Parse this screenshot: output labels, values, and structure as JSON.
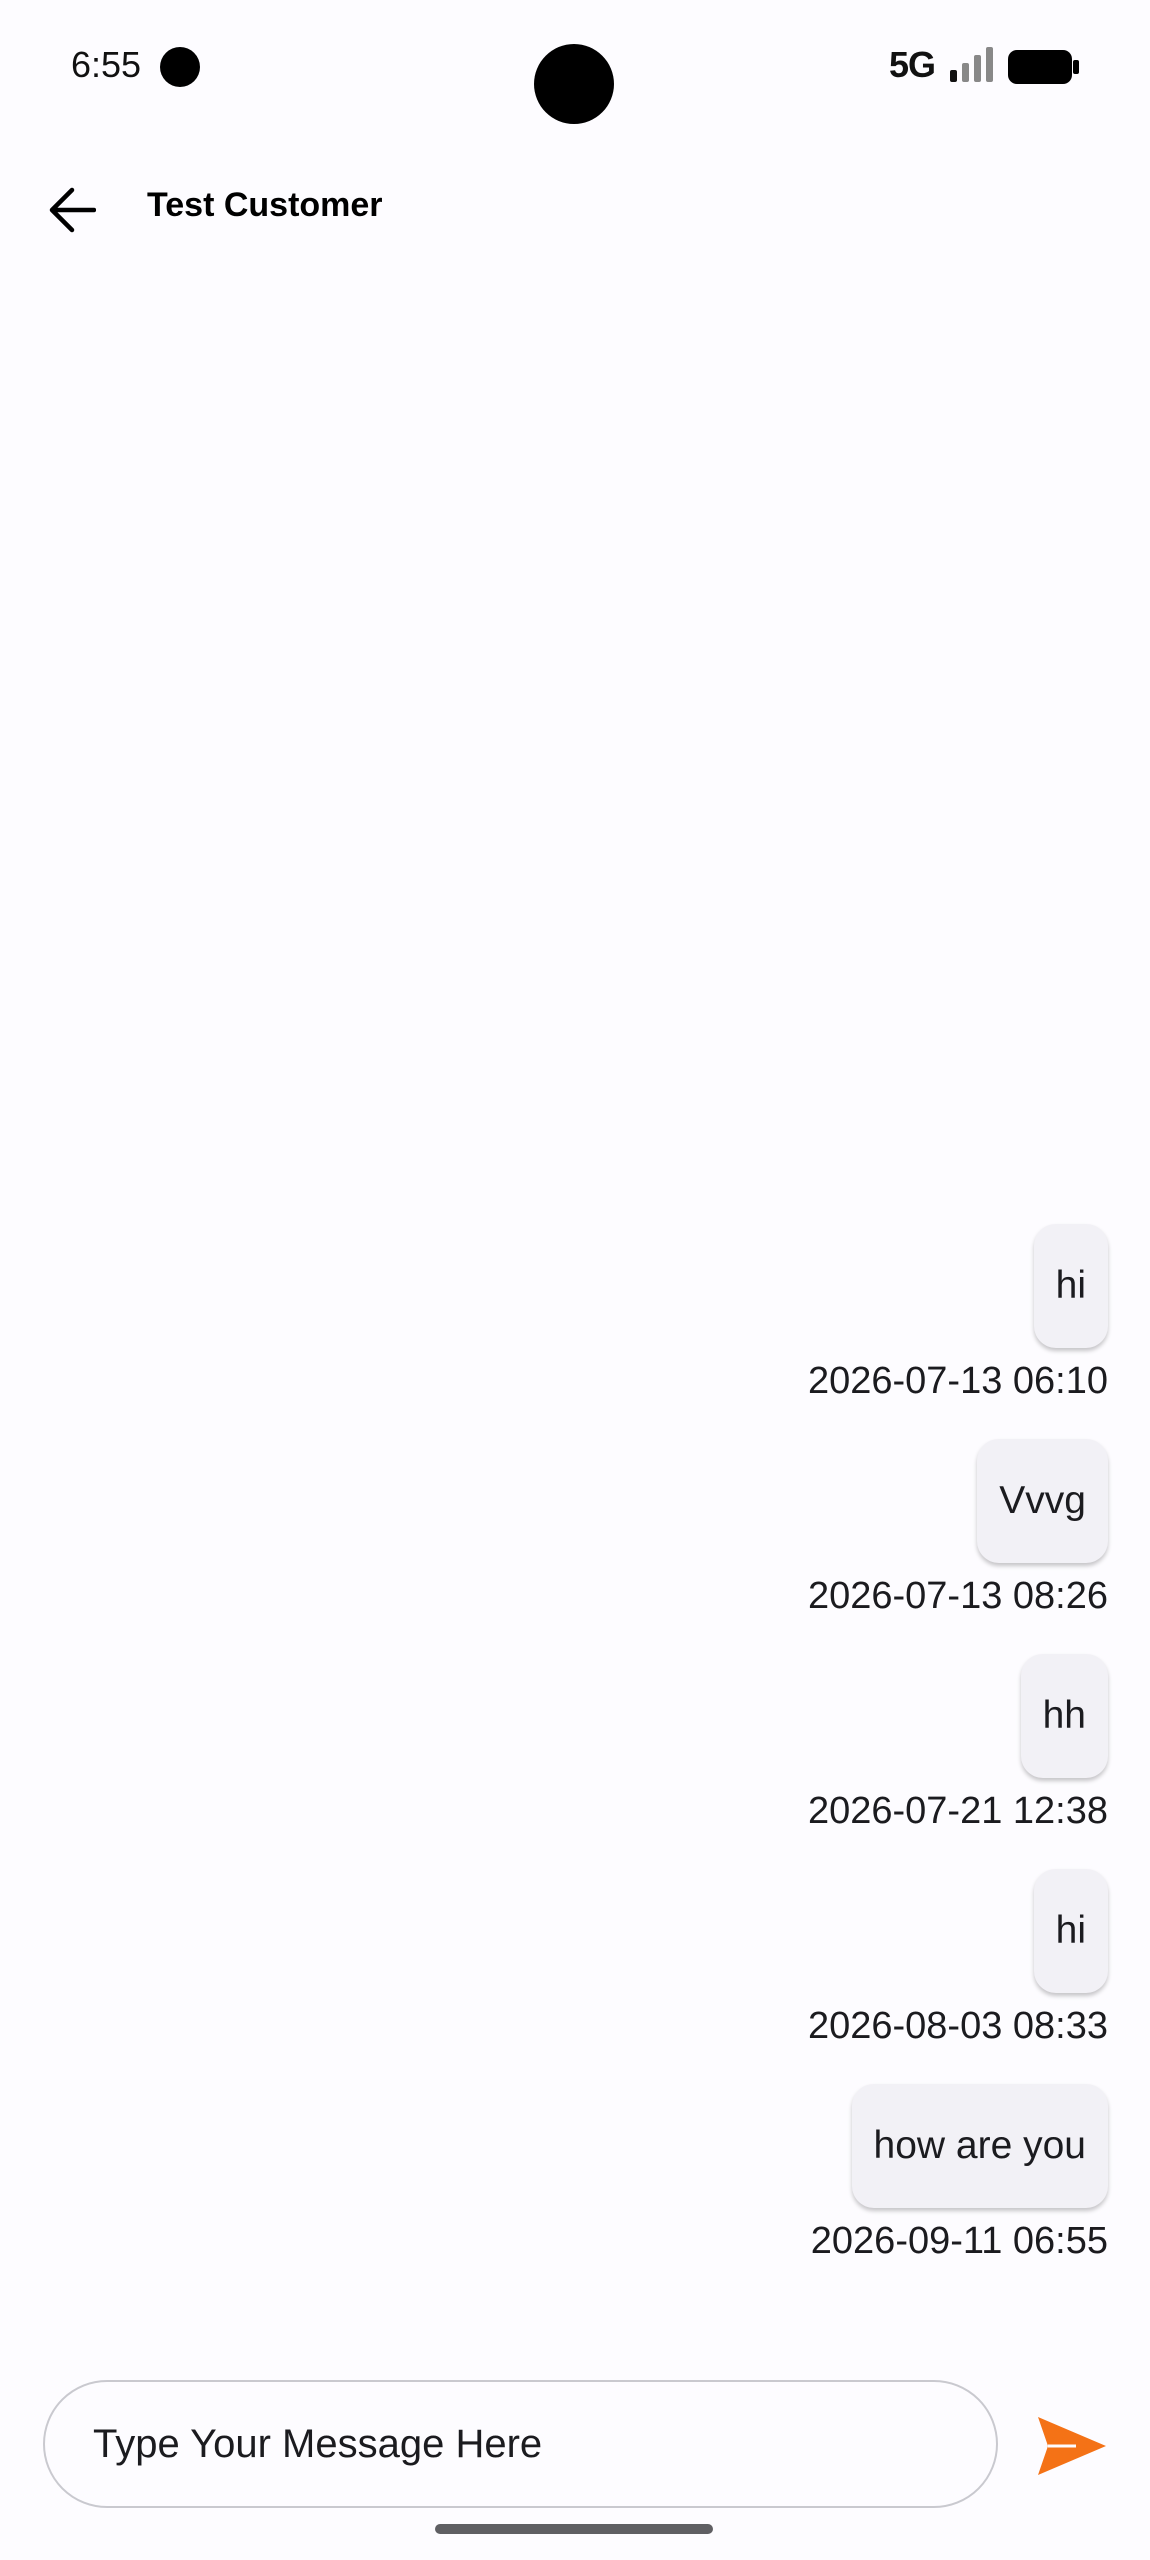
{
  "status_bar": {
    "time": "6:55",
    "network": "5G"
  },
  "header": {
    "title": "Test Customer",
    "back_icon": "arrow-back-icon"
  },
  "messages": [
    {
      "text": "hi",
      "timestamp": "2026-07-13 06:10"
    },
    {
      "text": "Vvvg",
      "timestamp": "2026-07-13 08:26"
    },
    {
      "text": "hh",
      "timestamp": "2026-07-21 12:38"
    },
    {
      "text": "hi",
      "timestamp": "2026-08-03 08:33"
    },
    {
      "text": "how are you",
      "timestamp": "2026-09-11 06:55"
    }
  ],
  "composer": {
    "placeholder": "Type Your Message Here",
    "value": "",
    "send_icon": "send-icon"
  },
  "colors": {
    "background": "#fdfcff",
    "bubble": "#f2f1f6",
    "accent": "#f47216",
    "text": "#1b1b1f"
  }
}
